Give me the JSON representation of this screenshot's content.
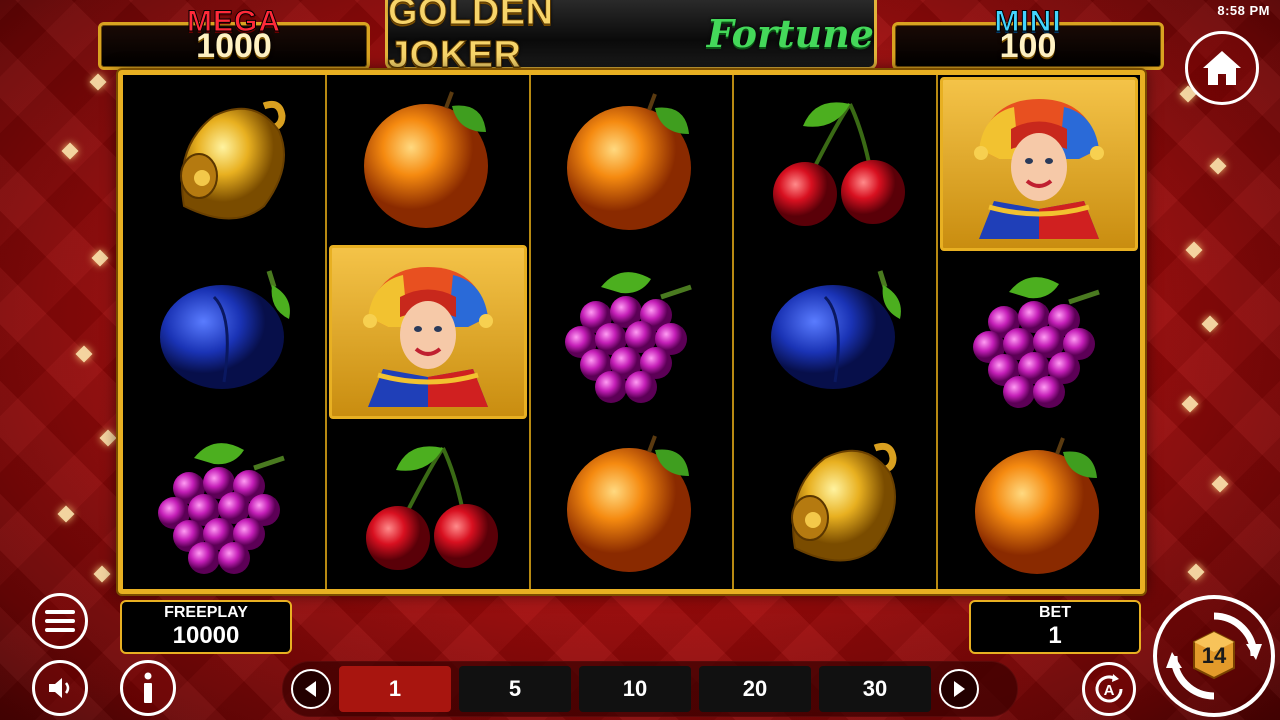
{
  "status_bar": {
    "time": "8:58 PM"
  },
  "jackpots": {
    "mega": {
      "label": "MEGA",
      "value": "1000"
    },
    "mini": {
      "label": "MINI",
      "value": "100"
    }
  },
  "logo": {
    "gold_text": "GOLDEN JOKER",
    "green_text": "Fortune"
  },
  "reels": [
    [
      "bell",
      "plum",
      "grapes"
    ],
    [
      "orange",
      "joker",
      "cherries"
    ],
    [
      "orange",
      "grapes",
      "orange"
    ],
    [
      "cherries",
      "plum",
      "bell"
    ],
    [
      "joker",
      "grapes",
      "orange"
    ]
  ],
  "freeplay": {
    "label": "FREEPLAY",
    "value": "10000"
  },
  "bet": {
    "label": "BET",
    "value": "1"
  },
  "bet_options": [
    {
      "label": "1",
      "selected": true
    },
    {
      "label": "5",
      "selected": false
    },
    {
      "label": "10",
      "selected": false
    },
    {
      "label": "20",
      "selected": false
    },
    {
      "label": "30",
      "selected": false
    }
  ],
  "spin_button": {
    "label": "14"
  },
  "icons": {
    "home": "home-icon",
    "menu": "hamburger-menu-icon",
    "sound": "speaker-icon",
    "info": "info-icon",
    "auto": "autoplay-icon",
    "spin": "spin-icon",
    "prev": "arrow-left-icon",
    "next": "arrow-right-icon"
  },
  "colors": {
    "frame_gold": "#e8b022",
    "background_red": "#b50d0d",
    "selected_bet": "#a8150f"
  }
}
